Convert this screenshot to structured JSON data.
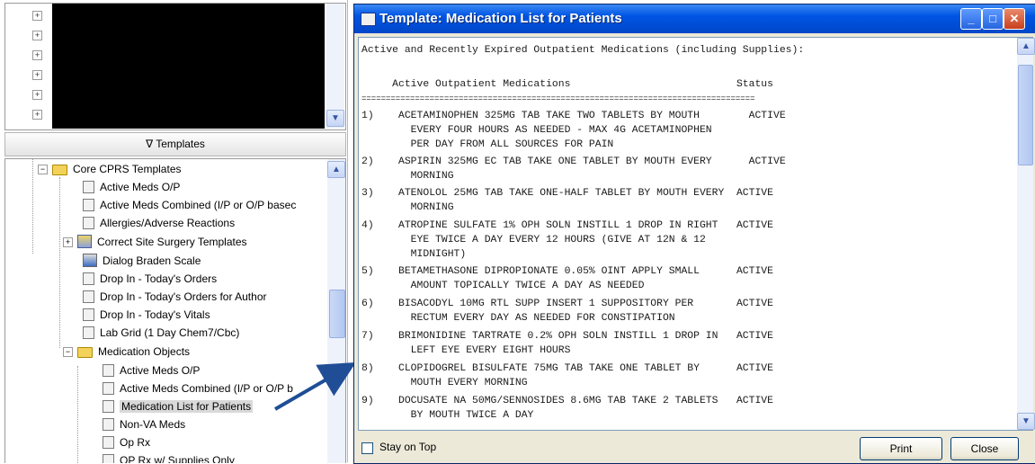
{
  "left_panel": {
    "templates_header": "∇ Templates",
    "tree": [
      {
        "label": "Core CPRS Templates",
        "icon": "folder-open-icon",
        "expander": "−"
      },
      {
        "label": "Active Meds O/P",
        "icon": "document-icon"
      },
      {
        "label": "Active Meds Combined (I/P or O/P basec",
        "icon": "document-icon"
      },
      {
        "label": "Allergies/Adverse Reactions",
        "icon": "document-icon"
      },
      {
        "label": "Correct Site Surgery Templates",
        "icon": "template-group-icon",
        "expander": "+"
      },
      {
        "label": "Dialog Braden Scale",
        "icon": "dialog-icon"
      },
      {
        "label": "Drop In - Today's Orders",
        "icon": "document-icon"
      },
      {
        "label": "Drop In - Today's Orders for Author",
        "icon": "document-icon"
      },
      {
        "label": "Drop In - Today's Vitals",
        "icon": "document-icon"
      },
      {
        "label": "Lab Grid (1 Day Chem7/Cbc)",
        "icon": "document-icon"
      },
      {
        "label": "Medication Objects",
        "icon": "folder-open-icon",
        "expander": "−"
      },
      {
        "label": "Active Meds O/P",
        "icon": "document-icon"
      },
      {
        "label": "Active Meds Combined (I/P or O/P b",
        "icon": "document-icon"
      },
      {
        "label": "Medication List for Patients",
        "icon": "document-icon",
        "selected": true
      },
      {
        "label": "Non-VA Meds",
        "icon": "document-icon"
      },
      {
        "label": "Op Rx",
        "icon": "document-icon"
      },
      {
        "label": "OP Rx w/ Supplies Only",
        "icon": "document-icon"
      }
    ]
  },
  "dialog": {
    "title": "Template: Medication List for Patients",
    "window_buttons": {
      "minimize": "_",
      "maximize": "□",
      "close": "✕"
    },
    "report_lines": [
      "Active and Recently Expired Outpatient Medications (including Supplies):",
      "",
      "     Active Outpatient Medications                           Status",
      "=================================================================================",
      "1)    ACETAMINOPHEN 325MG TAB TAKE TWO TABLETS BY MOUTH        ACTIVE",
      "        EVERY FOUR HOURS AS NEEDED - MAX 4G ACETAMINOPHEN",
      "        PER DAY FROM ALL SOURCES FOR PAIN",
      "2)    ASPIRIN 325MG EC TAB TAKE ONE TABLET BY MOUTH EVERY      ACTIVE",
      "        MORNING",
      "3)    ATENOLOL 25MG TAB TAKE ONE-HALF TABLET BY MOUTH EVERY  ACTIVE",
      "        MORNING",
      "4)    ATROPINE SULFATE 1% OPH SOLN INSTILL 1 DROP IN RIGHT   ACTIVE",
      "        EYE TWICE A DAY EVERY 12 HOURS (GIVE AT 12N & 12",
      "        MIDNIGHT)",
      "5)    BETAMETHASONE DIPROPIONATE 0.05% OINT APPLY SMALL      ACTIVE",
      "        AMOUNT TOPICALLY TWICE A DAY AS NEEDED",
      "6)    BISACODYL 10MG RTL SUPP INSERT 1 SUPPOSITORY PER       ACTIVE",
      "        RECTUM EVERY DAY AS NEEDED FOR CONSTIPATION",
      "7)    BRIMONIDINE TARTRATE 0.2% OPH SOLN INSTILL 1 DROP IN   ACTIVE",
      "        LEFT EYE EVERY EIGHT HOURS",
      "8)    CLOPIDOGREL BISULFATE 75MG TAB TAKE ONE TABLET BY      ACTIVE",
      "        MOUTH EVERY MORNING",
      "9)    DOCUSATE NA 50MG/SENNOSIDES 8.6MG TAB TAKE 2 TABLETS   ACTIVE",
      "        BY MOUTH TWICE A DAY"
    ],
    "stay_on_top_label": "Stay on Top",
    "print_label": "Print",
    "close_label": "Close"
  },
  "colors": {
    "titlebar": "#0054e3",
    "arrow": "#1f4e96",
    "dialog_bg": "#ece9d8"
  }
}
